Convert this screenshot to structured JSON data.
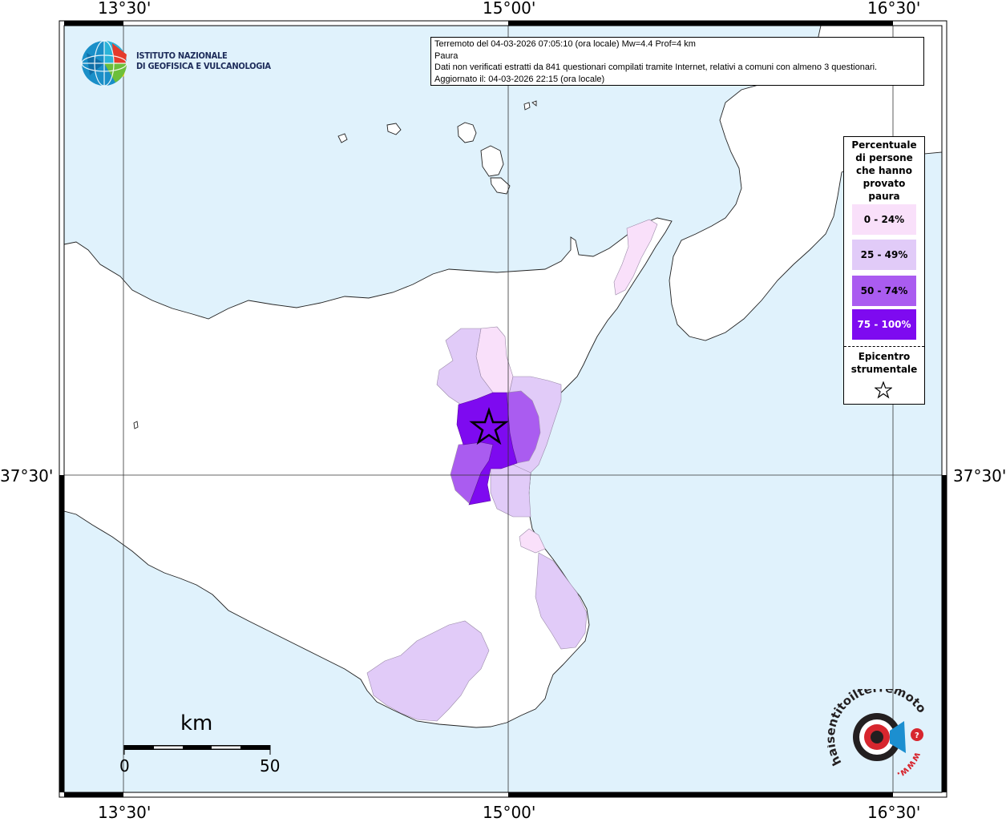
{
  "map": {
    "lon_labels": [
      "13°30'",
      "15°00'",
      "16°30'"
    ],
    "lat_labels": [
      "37°30'",
      "37°30'"
    ],
    "colors": {
      "sea": "#e0f2fc",
      "land": "#ffffff",
      "class_0_24": "#f9e0fa",
      "class_25_49": "#e1cbf8",
      "class_50_74": "#aa5cf0",
      "class_75_100": "#7e0af0"
    }
  },
  "info": {
    "line1": "Terremoto del 04-03-2026 07:05:10 (ora locale) Mw=4.4 Prof=4 km",
    "line2": "Paura",
    "line3": "Dati non verificati estratti da 841 questionari compilati tramite Internet, relativi a comuni con almeno 3 questionari.",
    "line4": "Aggiornato il: 04-03-2026 22:15 (ora locale)"
  },
  "ingv": {
    "line1": "ISTITUTO NAZIONALE",
    "line2": "DI GEOFISICA E VULCANOLOGIA"
  },
  "legend": {
    "title_lines": [
      "Percentuale",
      "di persone",
      "che hanno",
      "provato",
      "paura"
    ],
    "items": [
      {
        "label": "0 - 24%",
        "color": "#f9e0fa",
        "text_color": "#000000"
      },
      {
        "label": "25 - 49%",
        "color": "#e1cbf8",
        "text_color": "#000000"
      },
      {
        "label": "50 - 74%",
        "color": "#aa5cf0",
        "text_color": "#000000"
      },
      {
        "label": "75 - 100%",
        "color": "#7e0af0",
        "text_color": "#ffffff"
      }
    ],
    "epicenter_lines": [
      "Epicentro",
      "strumentale"
    ]
  },
  "scale": {
    "unit": "km",
    "start": "0",
    "end": "50"
  },
  "hs_logo": {
    "text": "haisentitoilterremoto.it",
    "www": "www."
  }
}
